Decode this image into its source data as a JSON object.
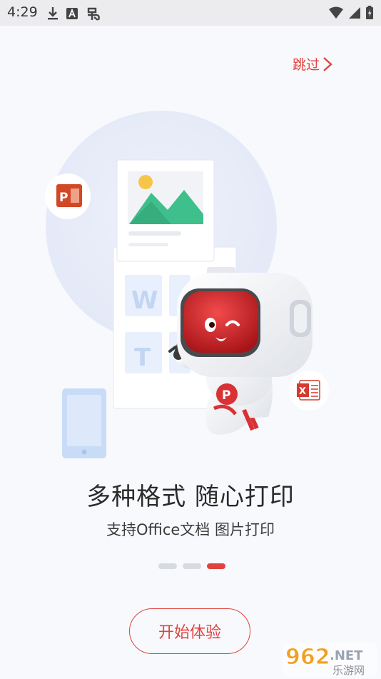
{
  "status_bar": {
    "time": "4:29",
    "icons_left": [
      "download-icon",
      "a-box-icon",
      "bug-icon"
    ],
    "icons_right": [
      "wifi-icon",
      "signal-icon",
      "battery-icon"
    ]
  },
  "skip_label": "跳过",
  "title": "多种格式  随心打印",
  "subtitle": "支持Office文档 图片打印",
  "pagination": {
    "count": 3,
    "active_index": 2
  },
  "start_button": "开始体验",
  "colors": {
    "accent": "#e0433f",
    "ppt": "#d24726",
    "excel": "#d33b2e",
    "doc_blue": "#bcd3f4"
  },
  "watermark": {
    "main": "962",
    "suffix": ".NET",
    "sub": "乐游网"
  }
}
